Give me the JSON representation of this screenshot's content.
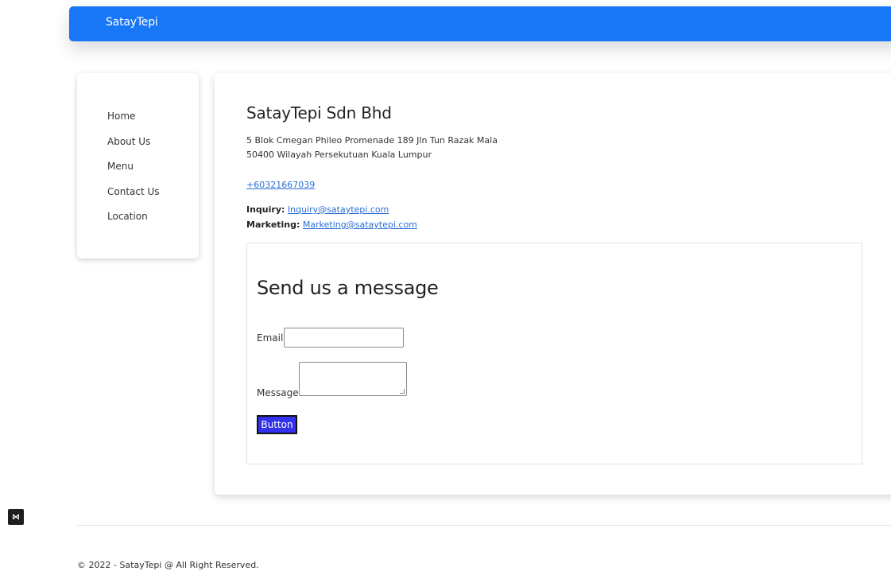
{
  "navbar": {
    "brand": "SatayTepi"
  },
  "sidebar": {
    "items": [
      {
        "label": "Home"
      },
      {
        "label": "About Us"
      },
      {
        "label": "Menu"
      },
      {
        "label": "Contact Us"
      },
      {
        "label": "Location"
      }
    ]
  },
  "contact": {
    "company": "SatayTepi Sdn Bhd",
    "address_line1": "5 Blok Cmegan Phileo Promenade 189 Jln Tun Razak Mala",
    "address_line2": "50400 Wilayah Persekutuan Kuala Lumpur",
    "phone": "+60321667039",
    "inquiry_label": "Inquiry:",
    "inquiry_email": "Inquiry@sataytepi.com",
    "marketing_label": "Marketing:",
    "marketing_email": "Marketing@sataytepi.com"
  },
  "form": {
    "title": "Send us a message",
    "email_label": "Email",
    "email_value": "",
    "message_label": "Message",
    "message_value": "",
    "button_label": "Button"
  },
  "footer": {
    "text": "© 2022 - SatayTepi @ All Right Reserved."
  },
  "icons": {
    "devtools": "visual-studio-icon"
  },
  "colors": {
    "navbar": "#1877f6",
    "button": "#3232ee",
    "link": "#2b6fd6"
  }
}
